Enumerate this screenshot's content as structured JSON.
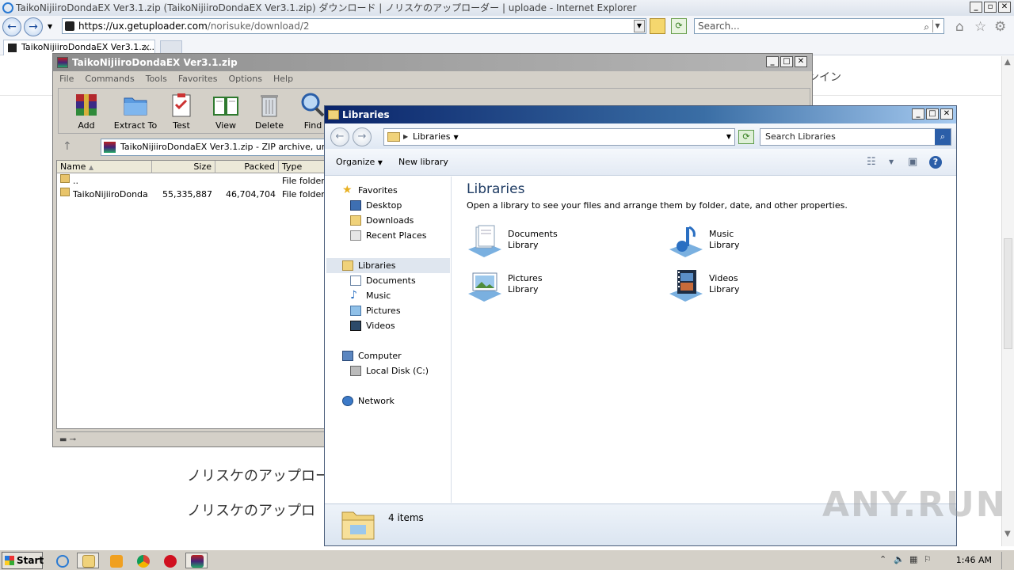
{
  "ie": {
    "title": "TaikoNijiiroDondaEX Ver3.1.zip (TaikoNijiiroDondaEX Ver3.1.zip) ダウンロード | ノリスケのアップローダー | uploade - Internet Explorer",
    "url_prefix": "https://",
    "url_host": "ux.getuploader.com",
    "url_path": "/norisuke/download/2",
    "search_placeholder": "Search...",
    "tab_label": "TaikoNijiiroDondaEX Ver3.1.z...",
    "tab_close": "×",
    "back_glyph": "←",
    "forward_glyph": "→",
    "icons": [
      "ie-logo-icon",
      "home-icon",
      "favorites-star-icon",
      "gear-icon"
    ]
  },
  "web": {
    "right_snippet": "ンイン",
    "heading1": "ノリスケのアップロー",
    "heading2": "ノリスケのアップロ"
  },
  "rar": {
    "title": "TaikoNijiiroDondaEX Ver3.1.zip",
    "menu": [
      "File",
      "Commands",
      "Tools",
      "Favorites",
      "Options",
      "Help"
    ],
    "tools": [
      "Add",
      "Extract To",
      "Test",
      "View",
      "Delete",
      "Find"
    ],
    "address": "TaikoNijiiroDondaEX Ver3.1.zip - ZIP archive, unpacked",
    "columns": [
      "Name",
      "Size",
      "Packed",
      "Type"
    ],
    "rows": [
      {
        "name": "..",
        "size": "",
        "packed": "",
        "type": "File folder"
      },
      {
        "name": "TaikoNijiiroDonda...",
        "size": "55,335,887",
        "packed": "46,704,704",
        "type": "File folder"
      }
    ]
  },
  "explorer": {
    "title": "Libraries",
    "breadcrumb": "Libraries",
    "search_placeholder": "Search Libraries",
    "cmd_organize": "Organize",
    "cmd_new_library": "New library",
    "nav": {
      "favorites": "Favorites",
      "desktop": "Desktop",
      "downloads": "Downloads",
      "recent": "Recent Places",
      "libraries": "Libraries",
      "documents": "Documents",
      "music": "Music",
      "pictures": "Pictures",
      "videos": "Videos",
      "computer": "Computer",
      "local_disk": "Local Disk (C:)",
      "network": "Network"
    },
    "heading": "Libraries",
    "description": "Open a library to see your files and arrange them by folder, date, and other properties.",
    "libraries": [
      {
        "name": "Documents",
        "sub": "Library"
      },
      {
        "name": "Music",
        "sub": "Library"
      },
      {
        "name": "Pictures",
        "sub": "Library"
      },
      {
        "name": "Videos",
        "sub": "Library"
      }
    ],
    "item_count": "4 items"
  },
  "taskbar": {
    "start": "Start",
    "clock": "1:46 AM"
  },
  "watermark": "ANY.RUN"
}
